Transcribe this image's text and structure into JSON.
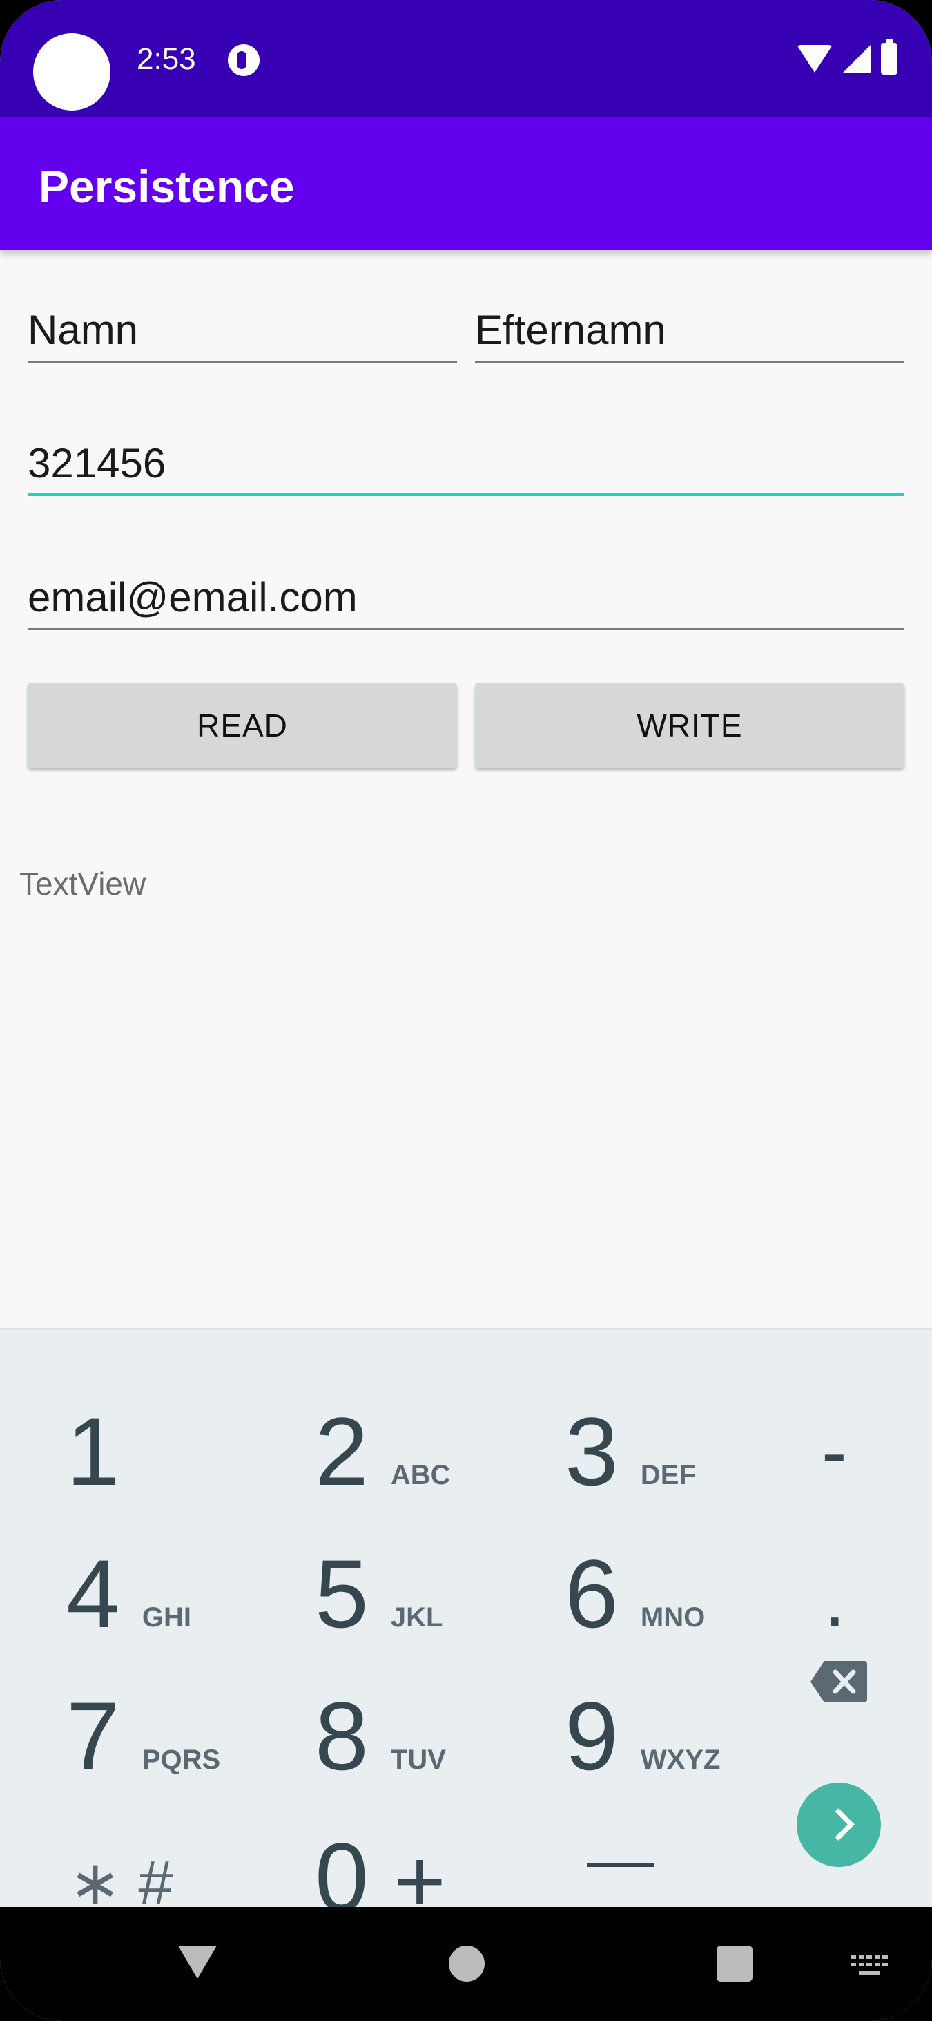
{
  "status_bar": {
    "time": "2:53"
  },
  "app_bar": {
    "title": "Persistence"
  },
  "form": {
    "first_name": {
      "value": "Namn"
    },
    "last_name": {
      "value": "Efternamn"
    },
    "phone": {
      "value": "321456"
    },
    "email": {
      "value": "email@email.com"
    }
  },
  "buttons": {
    "read": "READ",
    "write": "WRITE"
  },
  "output": {
    "text": "TextView"
  },
  "keyboard": {
    "keys": [
      {
        "digit": "1",
        "letters": ""
      },
      {
        "digit": "2",
        "letters": "ABC"
      },
      {
        "digit": "3",
        "letters": "DEF"
      },
      {
        "digit": "4",
        "letters": "GHI"
      },
      {
        "digit": "5",
        "letters": "JKL"
      },
      {
        "digit": "6",
        "letters": "MNO"
      },
      {
        "digit": "7",
        "letters": "PQRS"
      },
      {
        "digit": "8",
        "letters": "TUV"
      },
      {
        "digit": "9",
        "letters": "WXYZ"
      },
      {
        "digit": "0",
        "letters": ""
      }
    ],
    "minus": "-",
    "period": ".",
    "star_hash": "∗ #",
    "plus": "+"
  },
  "colors": {
    "status_bar": "#3700b3",
    "app_bar": "#6200ee",
    "focus_underline": "#1ed1c8",
    "enter_key": "#46b6a5"
  }
}
